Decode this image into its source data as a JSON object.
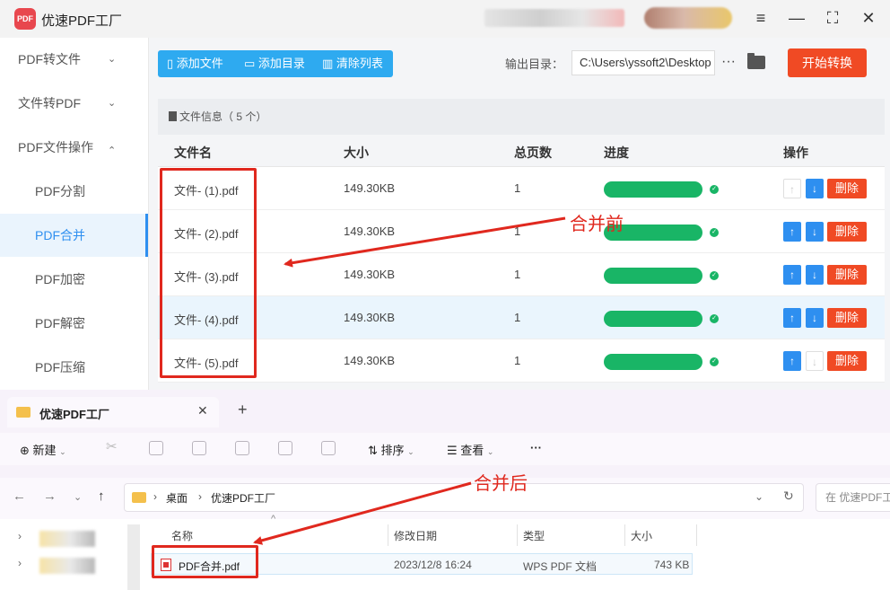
{
  "app": {
    "logo_text": "PDF",
    "title": "优速PDF工厂",
    "window_controls": [
      "menu-icon",
      "minimize-icon",
      "maximize-icon",
      "close-icon"
    ]
  },
  "sidebar": {
    "items": [
      {
        "label": "PDF转文件",
        "expandable": true,
        "chevron": "⌄"
      },
      {
        "label": "文件转PDF",
        "expandable": true,
        "chevron": "⌄"
      },
      {
        "label": "PDF文件操作",
        "expandable": true,
        "chevron": "⌃"
      },
      {
        "label": "PDF分割"
      },
      {
        "label": "PDF合并",
        "active": true
      },
      {
        "label": "PDF加密"
      },
      {
        "label": "PDF解密"
      },
      {
        "label": "PDF压缩"
      }
    ]
  },
  "toolbar": {
    "add_file": "添加文件",
    "add_dir": "添加目录",
    "clear_list": "清除列表",
    "output_label": "输出目录：",
    "output_path": "C:\\Users\\yssoft2\\Desktop",
    "more": "···",
    "start": "开始转换"
  },
  "file_info": {
    "label": "文件信息",
    "count": "（ 5 个）"
  },
  "table": {
    "headers": {
      "name": "文件名",
      "size": "大小",
      "pages": "总页数",
      "progress": "进度",
      "actions": "操作"
    },
    "delete_label": "删除",
    "up_icon": "↑",
    "down_icon": "↓",
    "rows": [
      {
        "name": "文件- (1).pdf",
        "size": "149.30KB",
        "pages": "1",
        "progress": 1.0,
        "up_disabled": true,
        "down_disabled": false
      },
      {
        "name": "文件- (2).pdf",
        "size": "149.30KB",
        "pages": "1",
        "progress": 1.0,
        "up_disabled": false,
        "down_disabled": false
      },
      {
        "name": "文件- (3).pdf",
        "size": "149.30KB",
        "pages": "1",
        "progress": 1.0,
        "up_disabled": false,
        "down_disabled": false
      },
      {
        "name": "文件- (4).pdf",
        "size": "149.30KB",
        "pages": "1",
        "progress": 1.0,
        "up_disabled": false,
        "down_disabled": false,
        "highlighted": true
      },
      {
        "name": "文件- (5).pdf",
        "size": "149.30KB",
        "pages": "1",
        "progress": 1.0,
        "up_disabled": false,
        "down_disabled": true
      }
    ]
  },
  "annotations": {
    "before": "合并前",
    "after": "合并后"
  },
  "explorer": {
    "tab_title": "优速PDF工厂",
    "tab_close": "✕",
    "tab_add": "+",
    "commands": {
      "new": "新建",
      "sort": "排序",
      "view": "查看",
      "more": "···"
    },
    "breadcrumb": [
      "桌面",
      "优速PDF工厂"
    ],
    "search_placeholder": "在 优速PDF工厂 中搜索",
    "columns": {
      "name": "名称",
      "modified": "修改日期",
      "type": "类型",
      "size": "大小"
    },
    "file": {
      "name": "PDF合并.pdf",
      "modified": "2023/12/8 16:24",
      "type": "WPS PDF 文档",
      "size": "743 KB"
    }
  },
  "colors": {
    "accent_blue": "#2e8ff0",
    "toolbar_blue": "#2eaaf0",
    "start_red": "#f04a24",
    "progress_green": "#19b566",
    "annotation_red": "#e0281e",
    "folder_yellow": "#f4c04c"
  }
}
